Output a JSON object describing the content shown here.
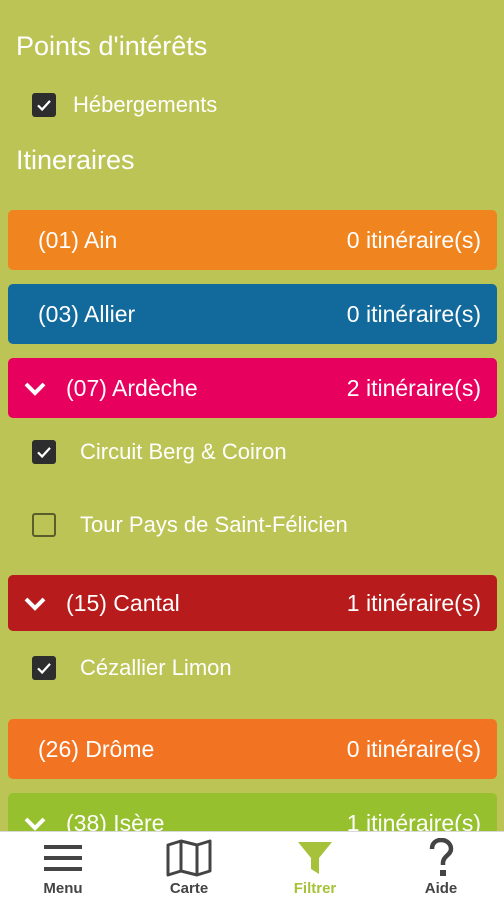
{
  "poi": {
    "title": "Points d'intérêts",
    "items": [
      {
        "label": "Hébergements",
        "checked": true
      }
    ]
  },
  "itineraries": {
    "title": "Itineraires"
  },
  "regions": [
    {
      "name": "(01) Ain",
      "count": "0 itinéraire(s)",
      "color": "#f0841f",
      "expanded": false
    },
    {
      "name": "(03) Allier",
      "count": "0 itinéraire(s)",
      "color": "#126a9c",
      "expanded": false
    },
    {
      "name": "(07) Ardèche",
      "count": "2 itinéraire(s)",
      "color": "#e8005e",
      "expanded": true,
      "routes": [
        {
          "label": "Circuit Berg & Coiron",
          "checked": true
        },
        {
          "label": "Tour Pays de Saint-Félicien",
          "checked": false
        }
      ]
    },
    {
      "name": "(15) Cantal",
      "count": "1 itinéraire(s)",
      "color": "#b81b1b",
      "expanded": true,
      "routes": [
        {
          "label": "Cézallier Limon",
          "checked": true
        }
      ]
    },
    {
      "name": "(26) Drôme",
      "count": "0 itinéraire(s)",
      "color": "#f27423",
      "expanded": false
    },
    {
      "name": "(38) Isère",
      "count": "1 itinéraire(s)",
      "color": "#96c02e",
      "expanded": true
    }
  ],
  "nav": {
    "items": [
      {
        "label": "Menu",
        "icon": "menu-icon",
        "active": false
      },
      {
        "label": "Carte",
        "icon": "map-icon",
        "active": false
      },
      {
        "label": "Filtrer",
        "icon": "filter-icon",
        "active": true
      },
      {
        "label": "Aide",
        "icon": "help-icon",
        "active": false
      }
    ],
    "active_color": "#a6c23a"
  }
}
